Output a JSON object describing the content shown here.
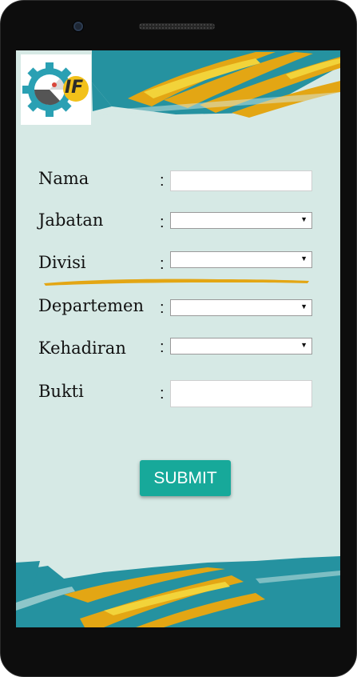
{
  "form": {
    "fields": [
      {
        "label": "Nama",
        "colon": ":",
        "type": "text",
        "value": ""
      },
      {
        "label": "Jabatan",
        "colon": ":",
        "type": "select",
        "value": ""
      },
      {
        "label": "Divisi",
        "colon": ":",
        "type": "select",
        "value": ""
      },
      {
        "label": "Departemen",
        "colon": ":",
        "type": "select",
        "value": ""
      },
      {
        "label": "Kehadiran",
        "colon": ":",
        "type": "select",
        "value": ""
      },
      {
        "label": "Bukti",
        "colon": ":",
        "type": "file",
        "value": ""
      }
    ],
    "submit_label": "SUBMIT"
  },
  "logo": {
    "text": "IF",
    "icon": "gear-icon"
  },
  "colors": {
    "teal": "#2592a0",
    "gold": "#e3a614",
    "yellow": "#f2d33a",
    "background": "#d6e9e5",
    "button": "#17a99a"
  }
}
